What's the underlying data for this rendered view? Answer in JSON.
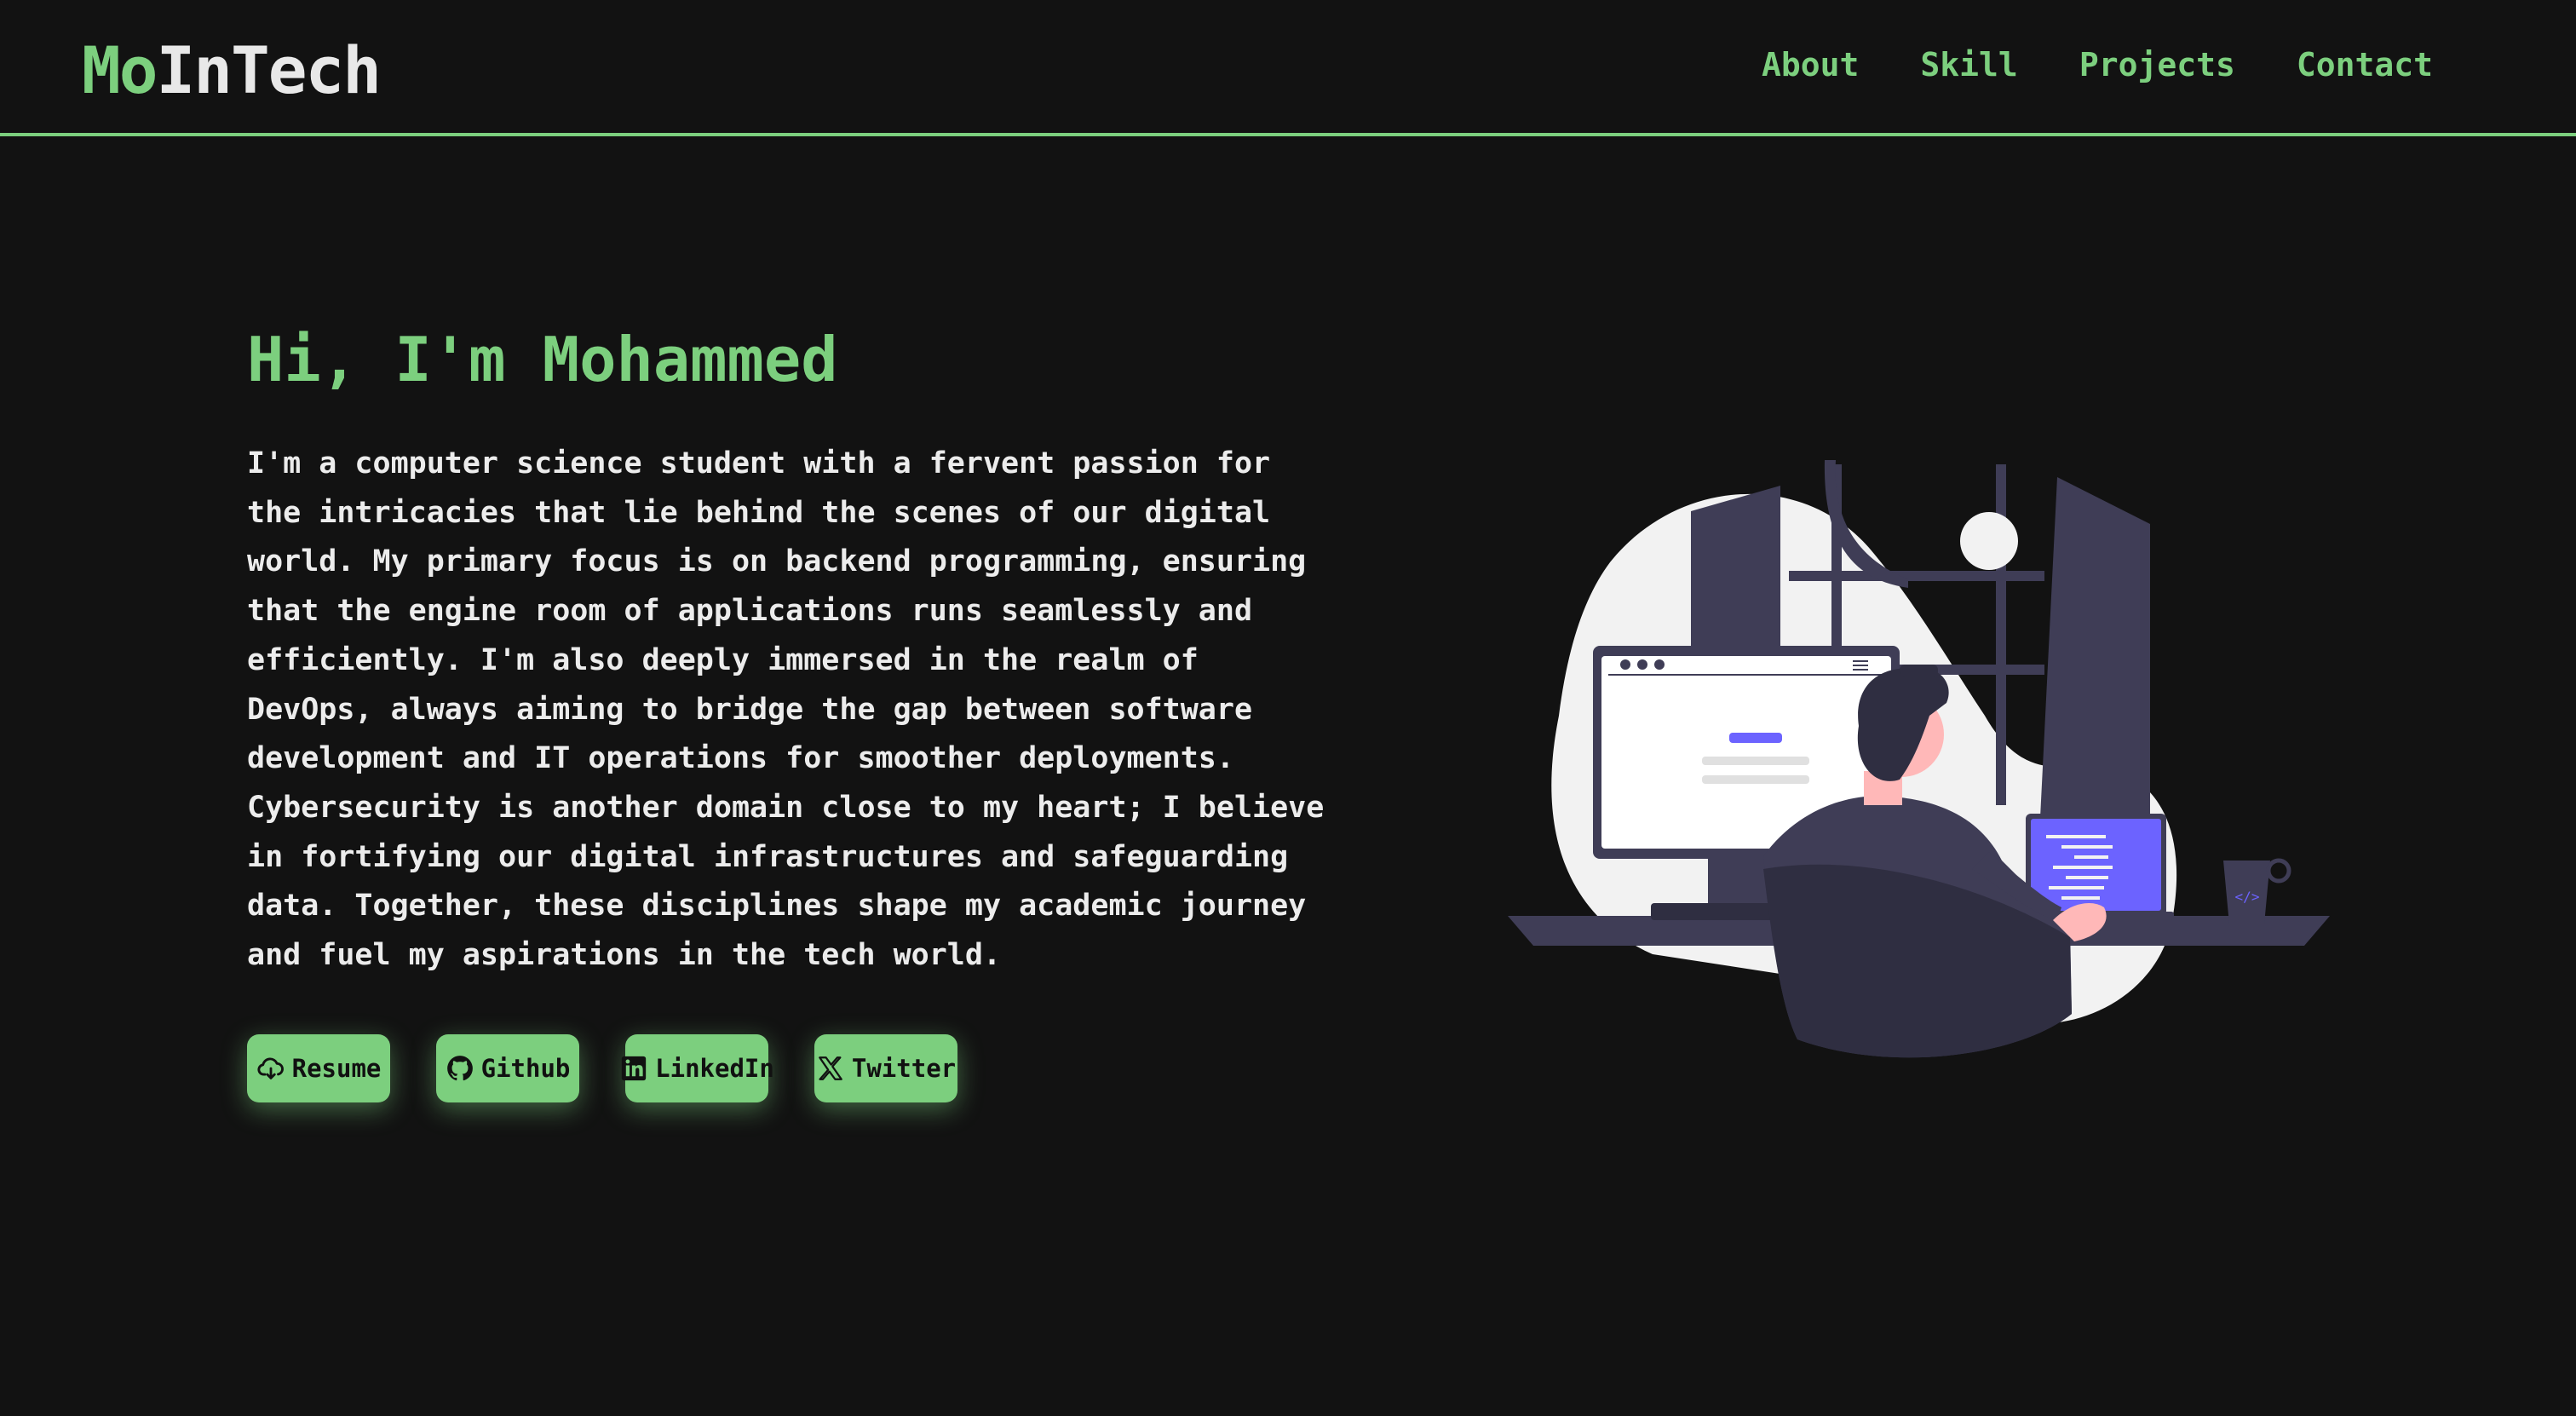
{
  "header": {
    "logo_prefix": "Mo",
    "logo_rest": "InTech",
    "nav": [
      "About",
      "Skill",
      "Projects",
      "Contact"
    ]
  },
  "hero": {
    "greeting": "Hi, I'm Mohammed",
    "bio": "I'm a computer science student with a fervent passion for the intricacies that lie behind the scenes of our digital world. My primary focus is on backend programming, ensuring that the engine room of applications runs seamlessly and efficiently. I'm also deeply immersed in the realm of DevOps, always aiming to bridge the gap between software development and IT operations for smoother deployments. Cybersecurity is another domain close to my heart; I believe in fortifying our digital infrastructures and safeguarding data. Together, these disciplines shape my academic journey and fuel my aspirations in the tech world.",
    "buttons": [
      {
        "label": "Resume",
        "icon": "cloud-download-icon"
      },
      {
        "label": "Github",
        "icon": "github-icon"
      },
      {
        "label": "LinkedIn",
        "icon": "linkedin-icon"
      },
      {
        "label": "Twitter",
        "icon": "x-twitter-icon"
      }
    ]
  },
  "illustration": {
    "name": "developer-at-desk-illustration",
    "laptop_tag": "</>"
  },
  "colors": {
    "background": "#121212",
    "accent": "#7ccf7e",
    "underline": "#b8433a",
    "figure_dark": "#3f3d56",
    "figure_purple": "#6c63ff"
  }
}
